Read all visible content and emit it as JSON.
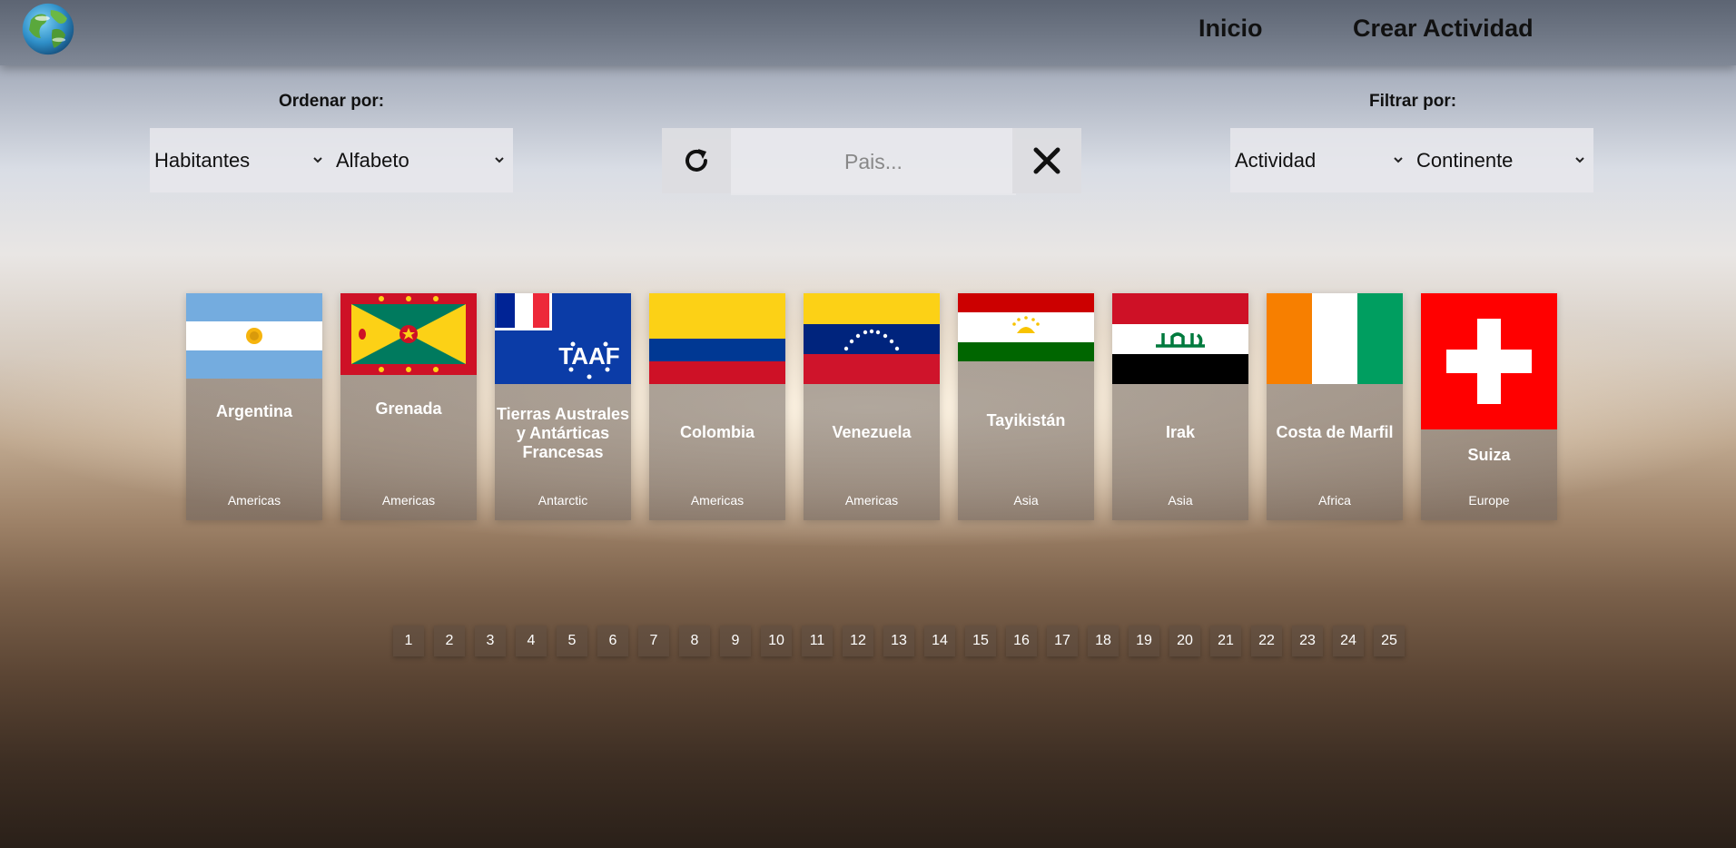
{
  "header": {
    "nav": [
      {
        "label": "Inicio"
      },
      {
        "label": "Crear Actividad"
      }
    ]
  },
  "sort": {
    "label": "Ordenar por:",
    "population_select": "Habitantes",
    "alphabet_select": "Alfabeto"
  },
  "filter": {
    "label": "Filtrar por:",
    "activity_select": "Actividad",
    "continent_select": "Continente"
  },
  "search": {
    "placeholder": "Pais..."
  },
  "countries": [
    {
      "name": "Argentina",
      "continent": "Americas",
      "flag": "argentina-flag"
    },
    {
      "name": "Grenada",
      "continent": "Americas",
      "flag": "grenada-flag"
    },
    {
      "name": "Tierras Australes y Antárticas Francesas",
      "continent": "Antarctic",
      "flag": "taaf-flag"
    },
    {
      "name": "Colombia",
      "continent": "Americas",
      "flag": "colombia-flag"
    },
    {
      "name": "Venezuela",
      "continent": "Americas",
      "flag": "venezuela-flag"
    },
    {
      "name": "Tayikistán",
      "continent": "Asia",
      "flag": "tajikistan-flag"
    },
    {
      "name": "Irak",
      "continent": "Asia",
      "flag": "iraq-flag"
    },
    {
      "name": "Costa de Marfil",
      "continent": "Africa",
      "flag": "ivory-coast-flag"
    },
    {
      "name": "Suiza",
      "continent": "Europe",
      "flag": "switzerland-flag"
    }
  ],
  "pagination": [
    "1",
    "2",
    "3",
    "4",
    "5",
    "6",
    "7",
    "8",
    "9",
    "10",
    "11",
    "12",
    "13",
    "14",
    "15",
    "16",
    "17",
    "18",
    "19",
    "20",
    "21",
    "22",
    "23",
    "24",
    "25"
  ],
  "icons": {
    "logo": "globe-logo-icon",
    "reset": "refresh-icon",
    "clear": "close-icon",
    "dropdown": "chevron-down-icon"
  },
  "colors": {
    "header_bg": "#5a6270",
    "card_text": "#ffffff",
    "nav_text": "#111111"
  }
}
